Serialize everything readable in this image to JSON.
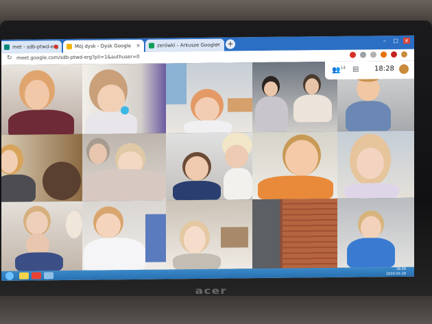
{
  "browser": {
    "tabs": [
      {
        "label": "met - sdb-ptwd-erg",
        "favicon_color": "#00897b"
      },
      {
        "label": "Mój dysk - Dysk Google",
        "favicon_color": "#f4b400"
      },
      {
        "label": "zerówki - Arkusze Google",
        "favicon_color": "#0f9d58"
      }
    ],
    "new_tab_label": "+",
    "url": "meet.google.com/sdb-ptwd-erg?pli=1&authuser=0"
  },
  "meet": {
    "participants_icon": "people-icon",
    "participants_count": "14",
    "chat_icon": "chat-icon",
    "time": "18:28"
  },
  "taskbar": {
    "clock_time": "18:28",
    "clock_date": "2020-05-28"
  },
  "laptop_brand": "acer",
  "colors": {
    "tabbar": "#2b6fc4",
    "taskbar": "#2f7dbd",
    "meet_grid_bg": "#202124"
  }
}
